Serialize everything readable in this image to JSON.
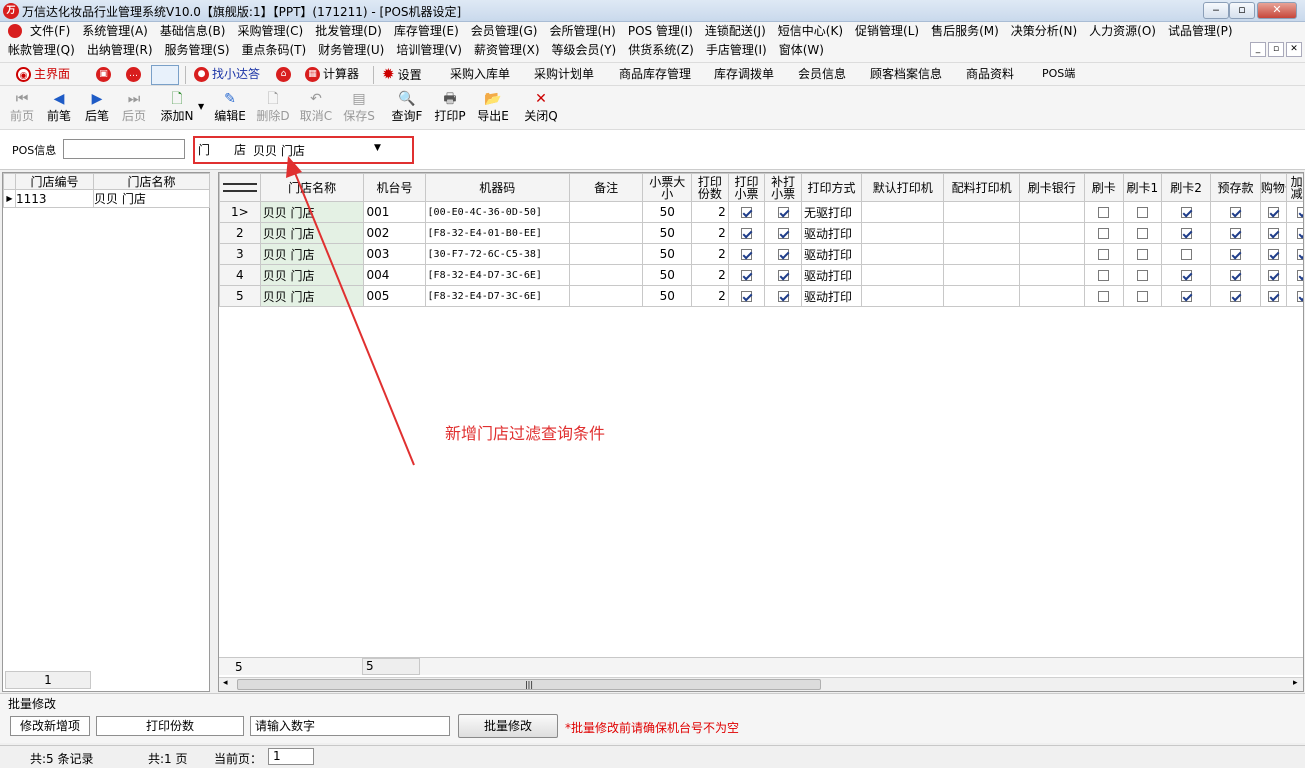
{
  "window": {
    "title": "万信达化妆品行业管理系统V10.0【旗舰版:1】【PPT】(171211) - [POS机器设定]",
    "icon_name": "app-logo-icon",
    "controls": [
      "minimize-icon",
      "restore-icon",
      "close-icon"
    ]
  },
  "menu": {
    "row1": [
      "文件(F)",
      "系统管理(A)",
      "基础信息(B)",
      "采购管理(C)",
      "批发管理(D)",
      "库存管理(E)",
      "会员管理(G)",
      "会所管理(H)",
      "POS 管理(I)",
      "连锁配送(J)",
      "短信中心(K)",
      "促销管理(L)",
      "售后服务(M)",
      "决策分析(N)",
      "人力资源(O)",
      "试品管理(P)"
    ],
    "row2": [
      "帐款管理(Q)",
      "出纳管理(R)",
      "服务管理(S)",
      "重点条码(T)",
      "财务管理(U)",
      "培训管理(V)",
      "薪资管理(X)",
      "等级会员(Y)",
      "供货系统(Z)",
      "手店管理(I)",
      "窗体(W)"
    ]
  },
  "quickbar": {
    "home": "主界面",
    "find": "找小达答",
    "calc": "计算器",
    "settings": "设置",
    "links": [
      "采购入库单",
      "采购计划单",
      "商品库存管理",
      "库存调拨单",
      "会员信息",
      "顾客档案信息",
      "商品资料",
      "POS端"
    ]
  },
  "toolbar": {
    "first": "前页",
    "prev": "前笔",
    "next": "后笔",
    "last": "后页",
    "add": "添加N",
    "edit": "编辑E",
    "delete": "删除D",
    "cancel": "取消C",
    "save": "保存S",
    "query": "查询F",
    "print": "打印P",
    "export": "导出E",
    "close": "关闭Q"
  },
  "filter": {
    "pos_label": "POS信息",
    "pos_value": "",
    "store_label": "门　　店",
    "store_value": "贝贝 门店",
    "highlight_color": "#e03030"
  },
  "left_grid": {
    "columns": [
      "门店编号",
      "门店名称"
    ],
    "rows": [
      [
        "1113",
        "贝贝 门店"
      ]
    ],
    "footer": "1"
  },
  "right_grid": {
    "columns": [
      "门店名称",
      "机台号",
      "机器码",
      "备注",
      "小票大小",
      "打印份数",
      "打印小票",
      "补打小票",
      "打印方式",
      "默认打印机",
      "配料打印机",
      "刷卡银行",
      "刷卡",
      "刷卡1",
      "刷卡2",
      "预存款",
      "购物卡",
      "加价减价"
    ],
    "rows": [
      {
        "no": "1",
        "store": "贝贝 门店",
        "machine_no": "001",
        "code": "[00-E0-4C-36-0D-50]",
        "note": "",
        "size": "50",
        "copies": "2",
        "print_ticket": true,
        "reprint": true,
        "mode": "无驱打印",
        "printer": "",
        "mix_printer": "",
        "bank": "",
        "card": false,
        "card1": false,
        "card2": true,
        "prepay": true,
        "gift": true,
        "markup": true
      },
      {
        "no": "2",
        "store": "贝贝 门店",
        "machine_no": "002",
        "code": "[F8-32-E4-01-B0-EE]",
        "note": "",
        "size": "50",
        "copies": "2",
        "print_ticket": true,
        "reprint": true,
        "mode": "驱动打印",
        "printer": "",
        "mix_printer": "",
        "bank": "",
        "card": false,
        "card1": false,
        "card2": true,
        "prepay": true,
        "gift": true,
        "markup": true
      },
      {
        "no": "3",
        "store": "贝贝 门店",
        "machine_no": "003",
        "code": "[30-F7-72-6C-C5-38]",
        "note": "",
        "size": "50",
        "copies": "2",
        "print_ticket": true,
        "reprint": true,
        "mode": "驱动打印",
        "printer": "",
        "mix_printer": "",
        "bank": "",
        "card": false,
        "card1": false,
        "card2": false,
        "prepay": true,
        "gift": true,
        "markup": true
      },
      {
        "no": "4",
        "store": "贝贝 门店",
        "machine_no": "004",
        "code": "[F8-32-E4-D7-3C-6E]",
        "note": "",
        "size": "50",
        "copies": "2",
        "print_ticket": true,
        "reprint": true,
        "mode": "驱动打印",
        "printer": "",
        "mix_printer": "",
        "bank": "",
        "card": false,
        "card1": false,
        "card2": true,
        "prepay": true,
        "gift": true,
        "markup": true
      },
      {
        "no": "5",
        "store": "贝贝 门店",
        "machine_no": "005",
        "code": "[F8-32-E4-D7-3C-6E]",
        "note": "",
        "size": "50",
        "copies": "2",
        "print_ticket": true,
        "reprint": true,
        "mode": "驱动打印",
        "printer": "",
        "mix_printer": "",
        "bank": "",
        "card": false,
        "card1": false,
        "card2": true,
        "prepay": true,
        "gift": true,
        "markup": true
      }
    ],
    "footer_count": "5",
    "footer_machine": "5"
  },
  "annotation": {
    "text": "新增门店过滤查询条件",
    "color": "#e03030"
  },
  "batch": {
    "title": "批量修改",
    "field_label": "修改新增项",
    "field_value": "打印份数",
    "placeholder": "请输入数字",
    "button": "批量修改",
    "warning": "*批量修改前请确保机台号不为空",
    "warning_color": "#e00000"
  },
  "status": {
    "records": "共:5 条记录",
    "pages": "共:1 页",
    "current_label": "当前页：",
    "current_value": "1"
  }
}
